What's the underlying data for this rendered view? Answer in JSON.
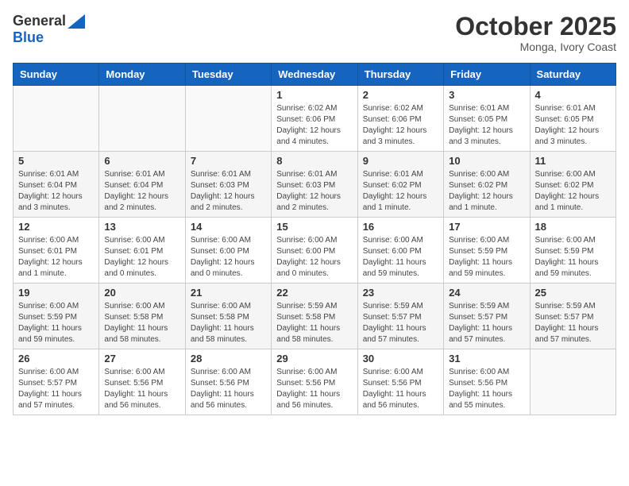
{
  "header": {
    "logo_general": "General",
    "logo_blue": "Blue",
    "month_title": "October 2025",
    "location": "Monga, Ivory Coast"
  },
  "days_of_week": [
    "Sunday",
    "Monday",
    "Tuesday",
    "Wednesday",
    "Thursday",
    "Friday",
    "Saturday"
  ],
  "weeks": [
    [
      {
        "day": "",
        "info": ""
      },
      {
        "day": "",
        "info": ""
      },
      {
        "day": "",
        "info": ""
      },
      {
        "day": "1",
        "info": "Sunrise: 6:02 AM\nSunset: 6:06 PM\nDaylight: 12 hours and 4 minutes."
      },
      {
        "day": "2",
        "info": "Sunrise: 6:02 AM\nSunset: 6:06 PM\nDaylight: 12 hours and 3 minutes."
      },
      {
        "day": "3",
        "info": "Sunrise: 6:01 AM\nSunset: 6:05 PM\nDaylight: 12 hours and 3 minutes."
      },
      {
        "day": "4",
        "info": "Sunrise: 6:01 AM\nSunset: 6:05 PM\nDaylight: 12 hours and 3 minutes."
      }
    ],
    [
      {
        "day": "5",
        "info": "Sunrise: 6:01 AM\nSunset: 6:04 PM\nDaylight: 12 hours and 3 minutes."
      },
      {
        "day": "6",
        "info": "Sunrise: 6:01 AM\nSunset: 6:04 PM\nDaylight: 12 hours and 2 minutes."
      },
      {
        "day": "7",
        "info": "Sunrise: 6:01 AM\nSunset: 6:03 PM\nDaylight: 12 hours and 2 minutes."
      },
      {
        "day": "8",
        "info": "Sunrise: 6:01 AM\nSunset: 6:03 PM\nDaylight: 12 hours and 2 minutes."
      },
      {
        "day": "9",
        "info": "Sunrise: 6:01 AM\nSunset: 6:02 PM\nDaylight: 12 hours and 1 minute."
      },
      {
        "day": "10",
        "info": "Sunrise: 6:00 AM\nSunset: 6:02 PM\nDaylight: 12 hours and 1 minute."
      },
      {
        "day": "11",
        "info": "Sunrise: 6:00 AM\nSunset: 6:02 PM\nDaylight: 12 hours and 1 minute."
      }
    ],
    [
      {
        "day": "12",
        "info": "Sunrise: 6:00 AM\nSunset: 6:01 PM\nDaylight: 12 hours and 1 minute."
      },
      {
        "day": "13",
        "info": "Sunrise: 6:00 AM\nSunset: 6:01 PM\nDaylight: 12 hours and 0 minutes."
      },
      {
        "day": "14",
        "info": "Sunrise: 6:00 AM\nSunset: 6:00 PM\nDaylight: 12 hours and 0 minutes."
      },
      {
        "day": "15",
        "info": "Sunrise: 6:00 AM\nSunset: 6:00 PM\nDaylight: 12 hours and 0 minutes."
      },
      {
        "day": "16",
        "info": "Sunrise: 6:00 AM\nSunset: 6:00 PM\nDaylight: 11 hours and 59 minutes."
      },
      {
        "day": "17",
        "info": "Sunrise: 6:00 AM\nSunset: 5:59 PM\nDaylight: 11 hours and 59 minutes."
      },
      {
        "day": "18",
        "info": "Sunrise: 6:00 AM\nSunset: 5:59 PM\nDaylight: 11 hours and 59 minutes."
      }
    ],
    [
      {
        "day": "19",
        "info": "Sunrise: 6:00 AM\nSunset: 5:59 PM\nDaylight: 11 hours and 59 minutes."
      },
      {
        "day": "20",
        "info": "Sunrise: 6:00 AM\nSunset: 5:58 PM\nDaylight: 11 hours and 58 minutes."
      },
      {
        "day": "21",
        "info": "Sunrise: 6:00 AM\nSunset: 5:58 PM\nDaylight: 11 hours and 58 minutes."
      },
      {
        "day": "22",
        "info": "Sunrise: 5:59 AM\nSunset: 5:58 PM\nDaylight: 11 hours and 58 minutes."
      },
      {
        "day": "23",
        "info": "Sunrise: 5:59 AM\nSunset: 5:57 PM\nDaylight: 11 hours and 57 minutes."
      },
      {
        "day": "24",
        "info": "Sunrise: 5:59 AM\nSunset: 5:57 PM\nDaylight: 11 hours and 57 minutes."
      },
      {
        "day": "25",
        "info": "Sunrise: 5:59 AM\nSunset: 5:57 PM\nDaylight: 11 hours and 57 minutes."
      }
    ],
    [
      {
        "day": "26",
        "info": "Sunrise: 6:00 AM\nSunset: 5:57 PM\nDaylight: 11 hours and 57 minutes."
      },
      {
        "day": "27",
        "info": "Sunrise: 6:00 AM\nSunset: 5:56 PM\nDaylight: 11 hours and 56 minutes."
      },
      {
        "day": "28",
        "info": "Sunrise: 6:00 AM\nSunset: 5:56 PM\nDaylight: 11 hours and 56 minutes."
      },
      {
        "day": "29",
        "info": "Sunrise: 6:00 AM\nSunset: 5:56 PM\nDaylight: 11 hours and 56 minutes."
      },
      {
        "day": "30",
        "info": "Sunrise: 6:00 AM\nSunset: 5:56 PM\nDaylight: 11 hours and 56 minutes."
      },
      {
        "day": "31",
        "info": "Sunrise: 6:00 AM\nSunset: 5:56 PM\nDaylight: 11 hours and 55 minutes."
      },
      {
        "day": "",
        "info": ""
      }
    ]
  ]
}
